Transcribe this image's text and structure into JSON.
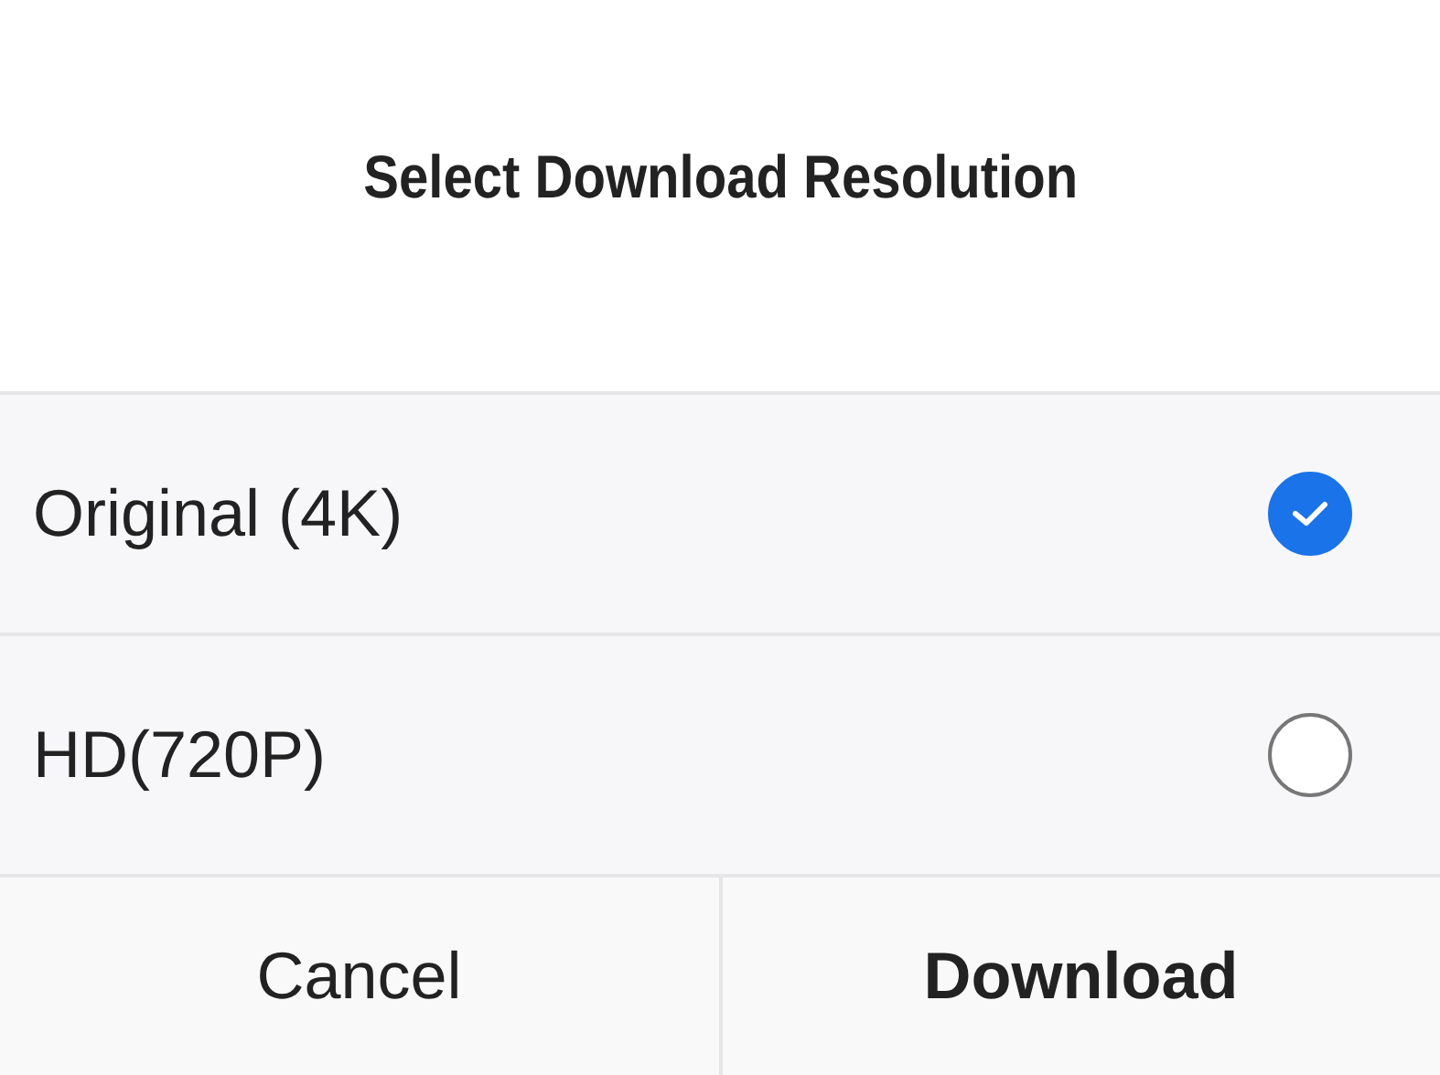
{
  "dialog": {
    "title": "Select Download Resolution"
  },
  "options": [
    {
      "label": "Original (4K)",
      "selected": true
    },
    {
      "label": "HD(720P)",
      "selected": false
    }
  ],
  "buttons": [
    {
      "label": "Cancel",
      "kind": "secondary"
    },
    {
      "label": "Download",
      "kind": "primary"
    }
  ]
}
